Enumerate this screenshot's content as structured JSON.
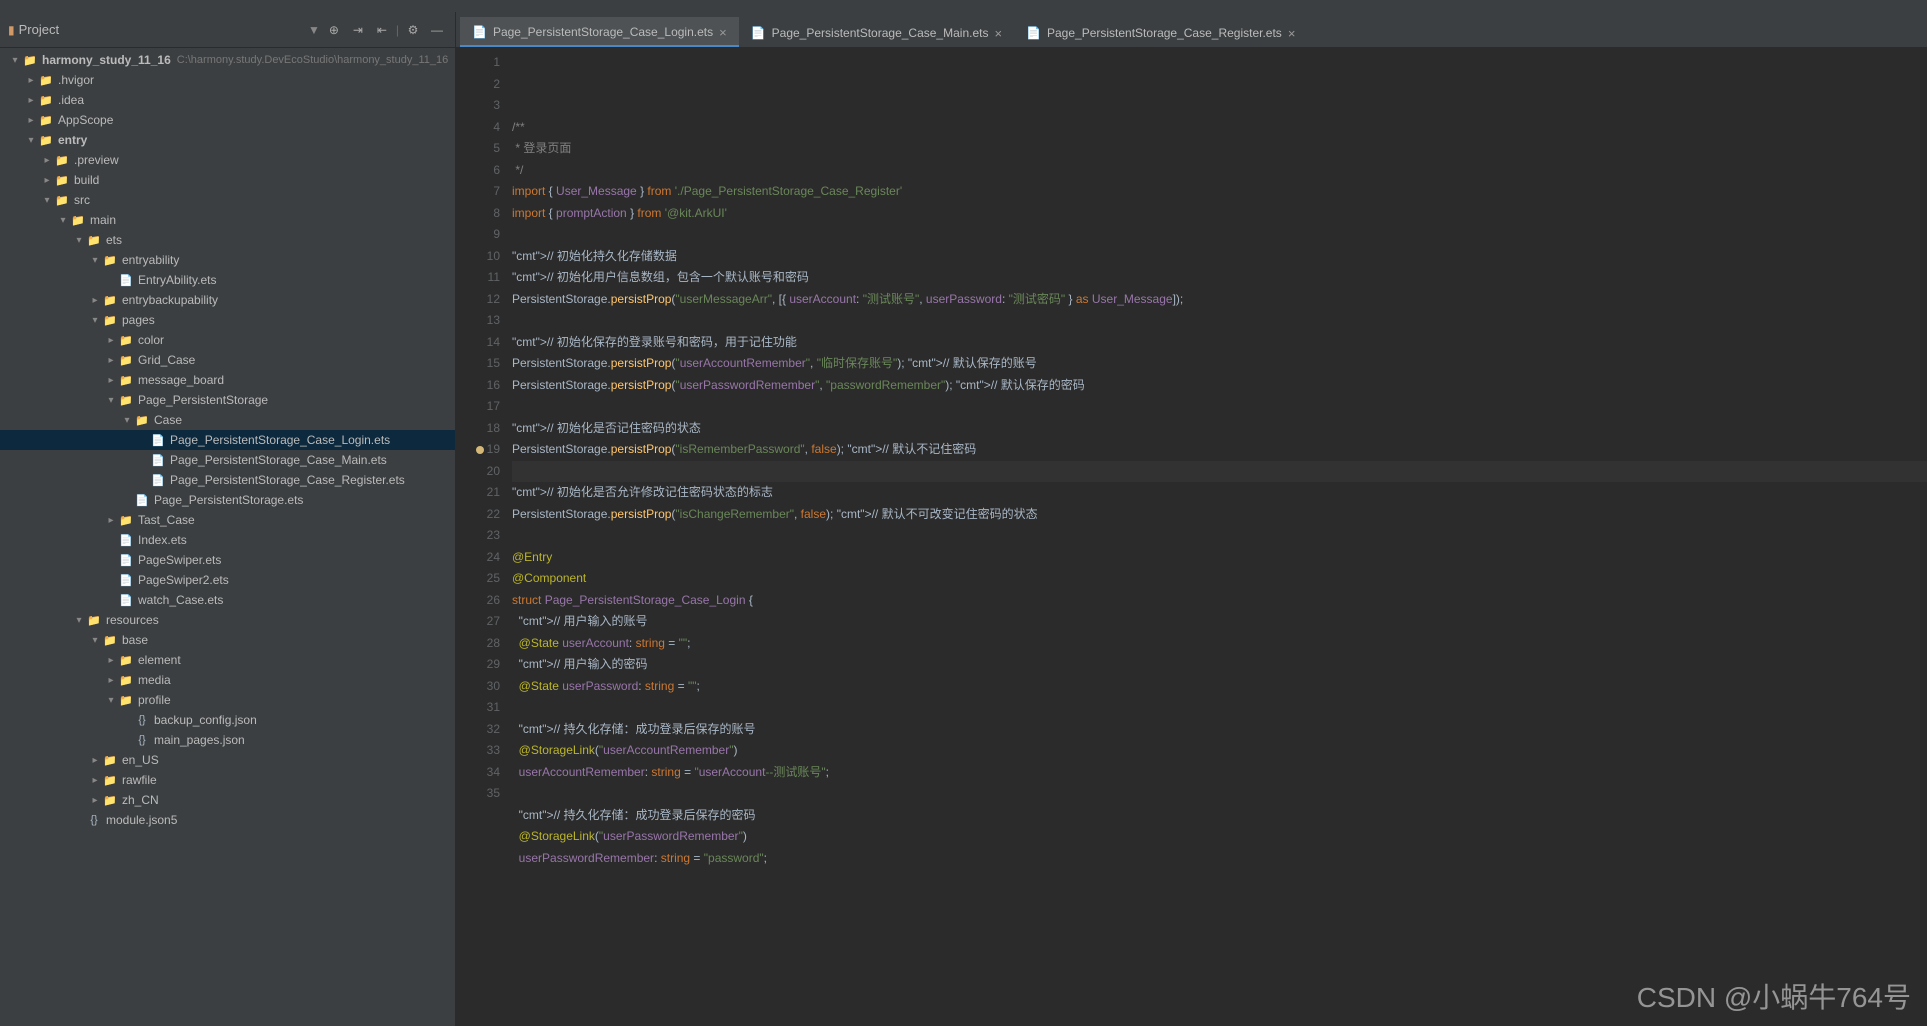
{
  "header": {
    "project_label": "Project",
    "icons": [
      "target-icon",
      "collapse-icon",
      "expand-icon",
      "divider",
      "gear-icon",
      "minimize-icon"
    ]
  },
  "tree": {
    "root_name": "harmony_study_11_16",
    "root_path": "C:\\harmony.study.DevEcoStudio\\harmony_study_11_16",
    "items": [
      {
        "d": 0,
        "a": "open",
        "i": "folder-blue",
        "n": "harmony_study_11_16",
        "bold": true,
        "path": "C:\\harmony.study.DevEcoStudio\\harmony_study_11_16"
      },
      {
        "d": 1,
        "a": "closed",
        "i": "folder",
        "n": ".hvigor"
      },
      {
        "d": 1,
        "a": "closed",
        "i": "folder",
        "n": ".idea"
      },
      {
        "d": 1,
        "a": "closed",
        "i": "folder",
        "n": "AppScope"
      },
      {
        "d": 1,
        "a": "open",
        "i": "folder-blue",
        "n": "entry",
        "bold": true
      },
      {
        "d": 2,
        "a": "closed",
        "i": "folder",
        "n": ".preview"
      },
      {
        "d": 2,
        "a": "closed",
        "i": "folder",
        "n": "build"
      },
      {
        "d": 2,
        "a": "open",
        "i": "folder",
        "n": "src"
      },
      {
        "d": 3,
        "a": "open",
        "i": "folder",
        "n": "main"
      },
      {
        "d": 4,
        "a": "open",
        "i": "folder",
        "n": "ets"
      },
      {
        "d": 5,
        "a": "open",
        "i": "folder",
        "n": "entryability"
      },
      {
        "d": 6,
        "a": "none",
        "i": "ets",
        "n": "EntryAbility.ets"
      },
      {
        "d": 5,
        "a": "closed",
        "i": "folder",
        "n": "entrybackupability"
      },
      {
        "d": 5,
        "a": "open",
        "i": "folder",
        "n": "pages"
      },
      {
        "d": 6,
        "a": "closed",
        "i": "folder",
        "n": "color"
      },
      {
        "d": 6,
        "a": "closed",
        "i": "folder",
        "n": "Grid_Case"
      },
      {
        "d": 6,
        "a": "closed",
        "i": "folder",
        "n": "message_board"
      },
      {
        "d": 6,
        "a": "open",
        "i": "folder",
        "n": "Page_PersistentStorage"
      },
      {
        "d": 7,
        "a": "open",
        "i": "folder",
        "n": "Case"
      },
      {
        "d": 8,
        "a": "none",
        "i": "ets",
        "n": "Page_PersistentStorage_Case_Login.ets",
        "sel": true
      },
      {
        "d": 8,
        "a": "none",
        "i": "ets",
        "n": "Page_PersistentStorage_Case_Main.ets"
      },
      {
        "d": 8,
        "a": "none",
        "i": "ets",
        "n": "Page_PersistentStorage_Case_Register.ets"
      },
      {
        "d": 7,
        "a": "none",
        "i": "ets",
        "n": "Page_PersistentStorage.ets"
      },
      {
        "d": 6,
        "a": "closed",
        "i": "folder",
        "n": "Tast_Case"
      },
      {
        "d": 6,
        "a": "none",
        "i": "ets",
        "n": "Index.ets"
      },
      {
        "d": 6,
        "a": "none",
        "i": "ets",
        "n": "PageSwiper.ets"
      },
      {
        "d": 6,
        "a": "none",
        "i": "ets",
        "n": "PageSwiper2.ets"
      },
      {
        "d": 6,
        "a": "none",
        "i": "ets",
        "n": "watch_Case.ets"
      },
      {
        "d": 4,
        "a": "open",
        "i": "folder",
        "n": "resources"
      },
      {
        "d": 5,
        "a": "open",
        "i": "folder",
        "n": "base"
      },
      {
        "d": 6,
        "a": "closed",
        "i": "folder",
        "n": "element"
      },
      {
        "d": 6,
        "a": "closed",
        "i": "folder",
        "n": "media"
      },
      {
        "d": 6,
        "a": "open",
        "i": "folder",
        "n": "profile"
      },
      {
        "d": 7,
        "a": "none",
        "i": "json",
        "n": "backup_config.json"
      },
      {
        "d": 7,
        "a": "none",
        "i": "json",
        "n": "main_pages.json"
      },
      {
        "d": 5,
        "a": "closed",
        "i": "folder",
        "n": "en_US"
      },
      {
        "d": 5,
        "a": "closed",
        "i": "folder",
        "n": "rawfile"
      },
      {
        "d": 5,
        "a": "closed",
        "i": "folder",
        "n": "zh_CN"
      },
      {
        "d": 4,
        "a": "none",
        "i": "json",
        "n": "module.json5"
      }
    ]
  },
  "tabs": [
    {
      "label": "Page_PersistentStorage_Case_Login.ets",
      "active": true
    },
    {
      "label": "Page_PersistentStorage_Case_Main.ets",
      "active": false
    },
    {
      "label": "Page_PersistentStorage_Case_Register.ets",
      "active": false
    }
  ],
  "editor": {
    "line_start": 1,
    "line_end": 35,
    "current_line": 20,
    "breakpoint_line": 19,
    "lines": [
      "/**",
      " * 登录页面",
      " */",
      "import { User_Message } from './Page_PersistentStorage_Case_Register'",
      "import { promptAction } from '@kit.ArkUI'",
      "",
      "// 初始化持久化存储数据",
      "// 初始化用户信息数组，包含一个默认账号和密码",
      "PersistentStorage.persistProp(\"userMessageArr\", [{ userAccount: \"测试账号\", userPassword: \"测试密码\" } as User_Message]);",
      "",
      "// 初始化保存的登录账号和密码，用于记住功能",
      "PersistentStorage.persistProp(\"userAccountRemember\", \"临时保存账号\"); // 默认保存的账号",
      "PersistentStorage.persistProp(\"userPasswordRemember\", \"passwordRemember\"); // 默认保存的密码",
      "",
      "// 初始化是否记住密码的状态",
      "PersistentStorage.persistProp(\"isRememberPassword\", false); // 默认不记住密码",
      "",
      "// 初始化是否允许修改记住密码状态的标志",
      "PersistentStorage.persistProp(\"isChangeRemember\", false); // 默认不可改变记住密码的状态",
      "",
      "@Entry",
      "@Component",
      "struct Page_PersistentStorage_Case_Login {",
      "  // 用户输入的账号",
      "  @State userAccount: string = \"\";",
      "  // 用户输入的密码",
      "  @State userPassword: string = \"\";",
      "",
      "  // 持久化存储：成功登录后保存的账号",
      "  @StorageLink(\"userAccountRemember\")",
      "  userAccountRemember: string = \"userAccount--测试账号\";",
      "",
      "  // 持久化存储：成功登录后保存的密码",
      "  @StorageLink(\"userPasswordRemember\")",
      "  userPasswordRemember: string = \"password\";"
    ]
  },
  "watermark": "CSDN @小蜗牛764号"
}
